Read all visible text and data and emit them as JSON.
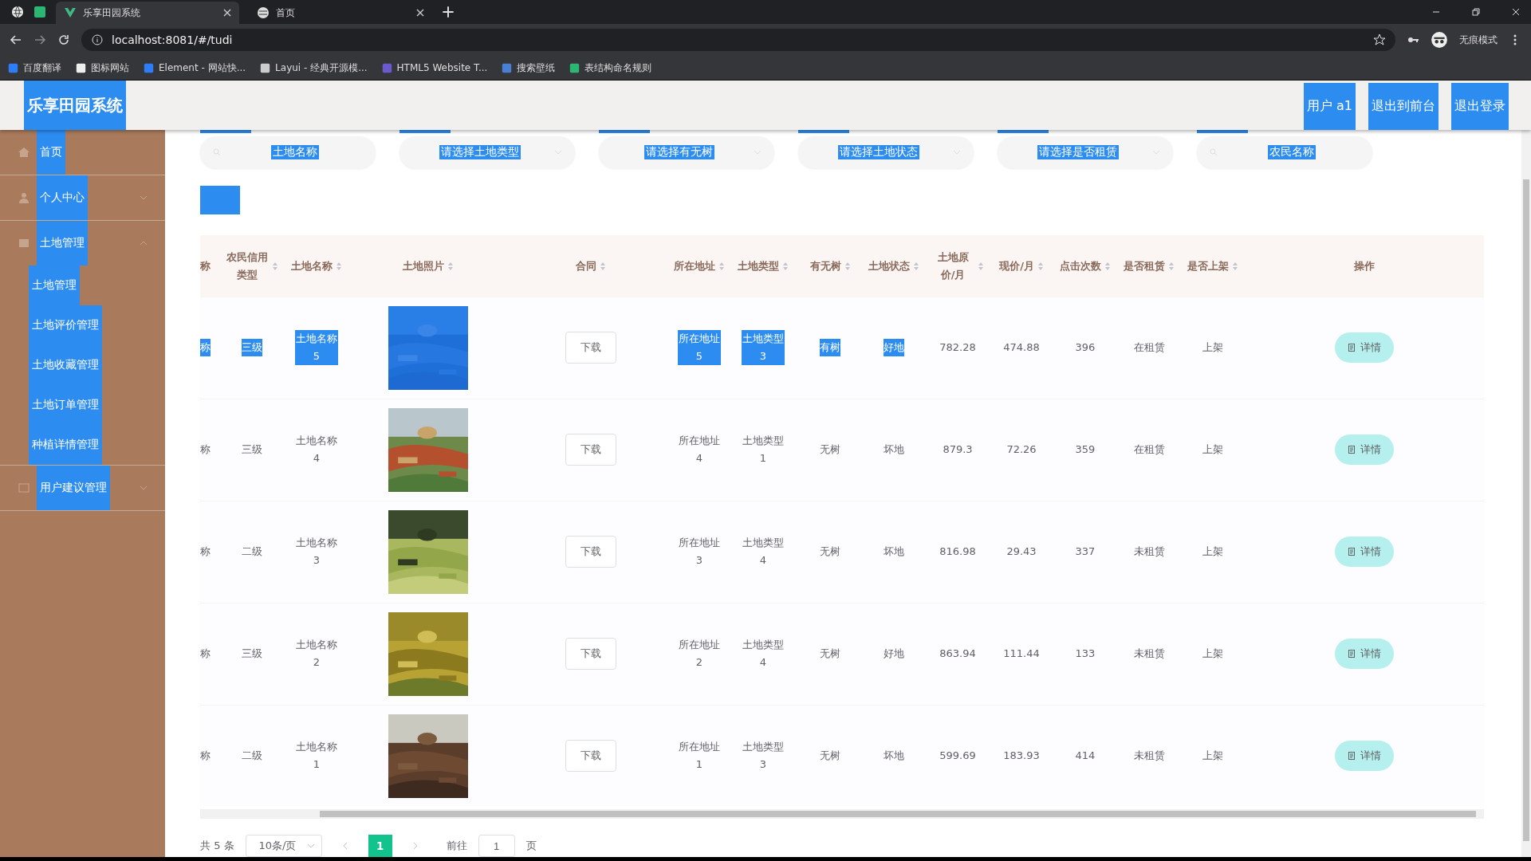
{
  "browser": {
    "tabs": [
      {
        "title": "乐享田园系统",
        "selected": true
      },
      {
        "title": "首页",
        "selected": false
      }
    ],
    "url": "localhost:8081/#/tudi",
    "profile": "无痕模式",
    "bookmarks": [
      "百度翻译",
      "图标网站",
      "Element - 网站快...",
      "Layui - 经典开源模...",
      "HTML5 Website T...",
      "搜索壁纸",
      "表结构命名规则"
    ]
  },
  "header": {
    "title": "乐享田园系统",
    "actions": [
      "用户 a1",
      "退出到前台",
      "退出登录"
    ]
  },
  "sidebar": {
    "items": [
      {
        "label": "首页"
      },
      {
        "label": "个人中心",
        "expanded": false
      },
      {
        "label": "土地管理",
        "expanded": true,
        "children": [
          {
            "label": "土地管理"
          },
          {
            "label": "土地评价管理"
          },
          {
            "label": "土地收藏管理"
          },
          {
            "label": "土地订单管理"
          },
          {
            "label": "种植详情管理"
          }
        ]
      },
      {
        "label": "用户建议管理",
        "expanded": false
      }
    ]
  },
  "filters": [
    {
      "kind": "input",
      "placeholder": "土地名称"
    },
    {
      "kind": "select",
      "placeholder": "请选择土地类型"
    },
    {
      "kind": "select",
      "placeholder": "请选择有无树"
    },
    {
      "kind": "select",
      "placeholder": "请选择土地状态"
    },
    {
      "kind": "select",
      "placeholder": "请选择是否租赁"
    },
    {
      "kind": "input",
      "placeholder": "农民名称"
    }
  ],
  "table": {
    "columns": [
      {
        "label": "称",
        "sortable": false
      },
      {
        "label": "农民信用类型",
        "sortable": true
      },
      {
        "label": "土地名称",
        "sortable": true
      },
      {
        "label": "土地照片",
        "sortable": true
      },
      {
        "label": "合同",
        "sortable": true
      },
      {
        "label": "所在地址",
        "sortable": true
      },
      {
        "label": "土地类型",
        "sortable": true
      },
      {
        "label": "有无树",
        "sortable": true
      },
      {
        "label": "土地状态",
        "sortable": true
      },
      {
        "label": "土地原价/月",
        "sortable": true
      },
      {
        "label": "现价/月",
        "sortable": true
      },
      {
        "label": "点击次数",
        "sortable": true
      },
      {
        "label": "是否租赁",
        "sortable": true
      },
      {
        "label": "是否上架",
        "sortable": true
      },
      {
        "label": "操作",
        "sortable": false
      }
    ],
    "rows": [
      {
        "selected": true,
        "cells": [
          "称",
          "三级",
          "土地名称5",
          "",
          "下载",
          "所在地址5",
          "土地类型3",
          "有树",
          "好地",
          "782.28",
          "474.88",
          "396",
          "在租赁",
          "上架",
          "详情"
        ]
      },
      {
        "selected": false,
        "cells": [
          "称",
          "三级",
          "土地名称4",
          "",
          "下载",
          "所在地址4",
          "土地类型1",
          "无树",
          "坏地",
          "879.3",
          "72.26",
          "359",
          "在租赁",
          "上架",
          "详情"
        ]
      },
      {
        "selected": false,
        "cells": [
          "称",
          "二级",
          "土地名称3",
          "",
          "下载",
          "所在地址3",
          "土地类型4",
          "无树",
          "坏地",
          "816.98",
          "29.43",
          "337",
          "未租赁",
          "上架",
          "详情"
        ]
      },
      {
        "selected": false,
        "cells": [
          "称",
          "三级",
          "土地名称2",
          "",
          "下载",
          "所在地址2",
          "土地类型4",
          "无树",
          "好地",
          "863.94",
          "111.44",
          "133",
          "未租赁",
          "上架",
          "详情"
        ]
      },
      {
        "selected": false,
        "cells": [
          "称",
          "二级",
          "土地名称1",
          "",
          "下载",
          "所在地址1",
          "土地类型3",
          "无树",
          "坏地",
          "599.69",
          "183.93",
          "414",
          "未租赁",
          "上架",
          "详情"
        ]
      }
    ]
  },
  "pagination": {
    "total": "共 5 条",
    "page_size": "10条/页",
    "pages": [
      {
        "label": "1",
        "selected": true
      }
    ],
    "goto_label": "前往",
    "goto_value": "1",
    "goto_suffix": "页"
  }
}
